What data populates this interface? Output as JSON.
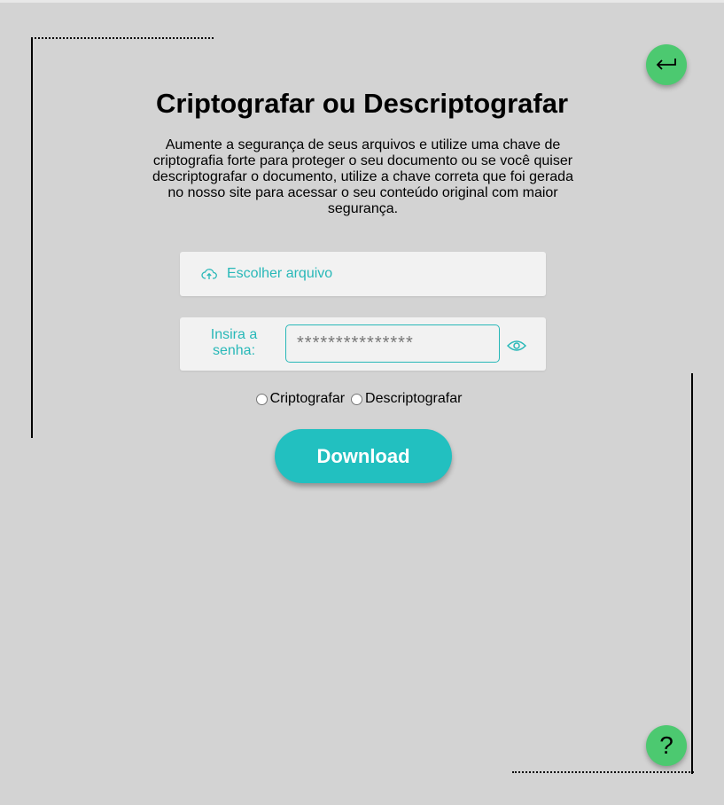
{
  "title": "Criptografar ou Descriptografar",
  "description": "Aumente a segurança de seus arquivos e utilize uma chave de criptografia forte para proteger o seu documento ou se você quiser descriptografar o documento, utilize a chave correta que foi gerada no nosso site para acessar o seu conteúdo original com maior segurança.",
  "file": {
    "label": "Escolher arquivo",
    "icon": "cloud-upload-icon"
  },
  "password": {
    "label": "Insira a senha:",
    "placeholder": "***************",
    "value": "",
    "toggle_icon": "eye-icon"
  },
  "modes": [
    {
      "label": "Criptografar",
      "selected": false
    },
    {
      "label": "Descriptografar",
      "selected": false
    }
  ],
  "download_label": "Download",
  "back_icon": "return-arrow-icon",
  "help_label": "?",
  "colors": {
    "background": "#d3d3d3",
    "accent": "#22c0c0",
    "green": "#4cc970",
    "panel": "#f2f2f2"
  }
}
